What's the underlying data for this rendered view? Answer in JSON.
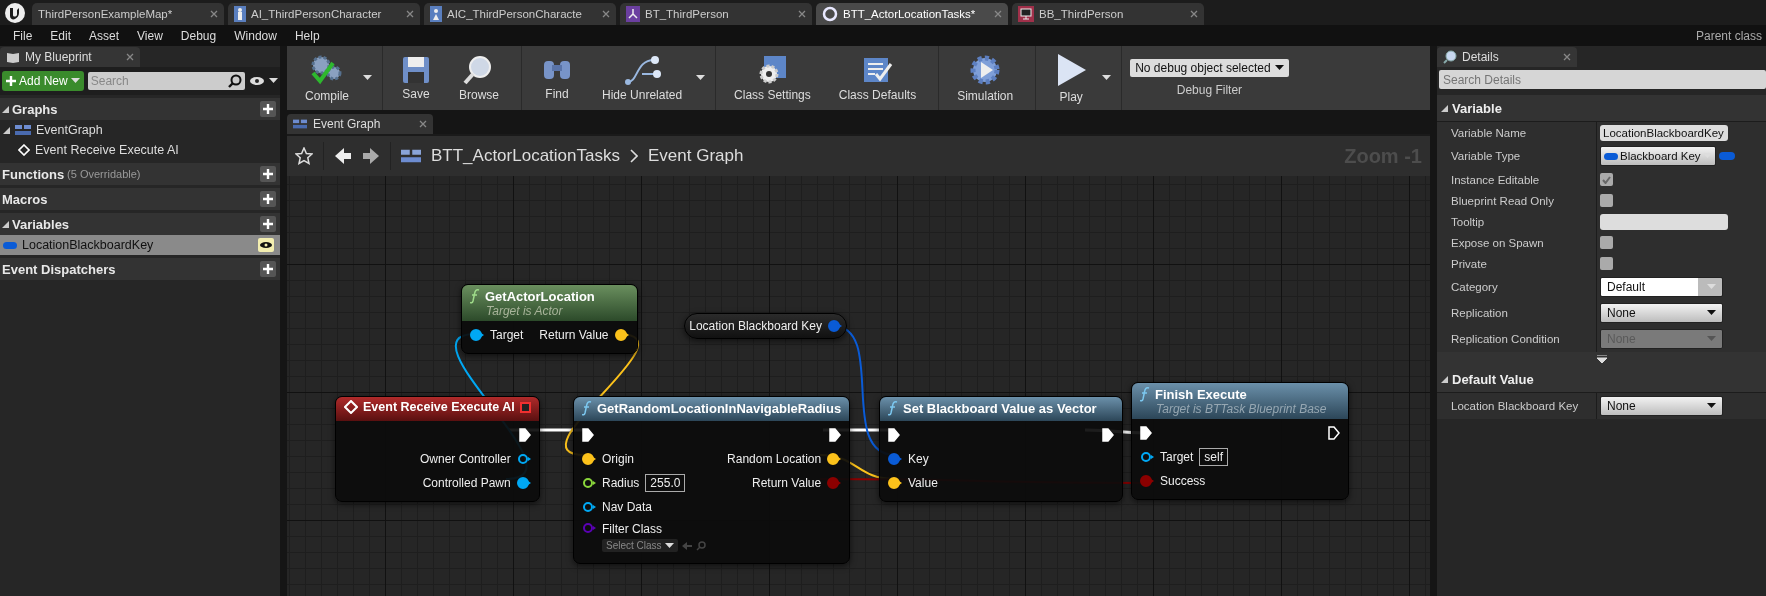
{
  "tabs": [
    {
      "label": "ThirdPersonExampleMap*",
      "kind": "level",
      "selected": false
    },
    {
      "label": "AI_ThirdPersonCharacter",
      "kind": "character",
      "selected": false
    },
    {
      "label": "AIC_ThirdPersonCharacte",
      "kind": "controller",
      "selected": false
    },
    {
      "label": "BT_ThirdPerson",
      "kind": "tree",
      "selected": false
    },
    {
      "label": "BTT_ActorLocationTasks*",
      "kind": "task",
      "selected": true
    },
    {
      "label": "BB_ThirdPerson",
      "kind": "blackboard",
      "selected": false
    }
  ],
  "menu": [
    "File",
    "Edit",
    "Asset",
    "View",
    "Debug",
    "Window",
    "Help"
  ],
  "parent_class": "Parent class",
  "my_blueprint": {
    "title": "My Blueprint",
    "add_button": "Add New",
    "search": {
      "placeholder": "Search"
    },
    "sections": [
      {
        "label": "Graphs",
        "expanded": true,
        "items": [
          {
            "label": "EventGraph",
            "kind": "graph",
            "selected": false,
            "children": [
              {
                "label": "Event Receive Execute AI",
                "kind": "event",
                "selected": false
              }
            ]
          }
        ]
      },
      {
        "label": "Functions",
        "note": "(5 Overridable)",
        "expanded": false
      },
      {
        "label": "Macros",
        "expanded": false
      },
      {
        "label": "Variables",
        "expanded": true,
        "items": [
          {
            "label": "LocationBlackboardKey",
            "kind": "variable",
            "selected": true
          }
        ]
      },
      {
        "label": "Event Dispatchers",
        "expanded": false
      }
    ]
  },
  "toolbar": {
    "groups": [
      [
        {
          "label": "Compile",
          "kind": "compile",
          "menu": true
        }
      ],
      [
        {
          "label": "Save",
          "kind": "save",
          "menu": false
        },
        {
          "label": "Browse",
          "kind": "browse",
          "menu": false
        }
      ],
      [
        {
          "label": "Find",
          "kind": "find",
          "menu": false
        },
        {
          "label": "Hide Unrelated",
          "kind": "hide",
          "menu": true
        }
      ],
      [
        {
          "label": "Class Settings",
          "kind": "settings",
          "menu": false
        },
        {
          "label": "Class Defaults",
          "kind": "defaults",
          "menu": false
        }
      ],
      [
        {
          "label": "Simulation",
          "kind": "simulation",
          "menu": false
        }
      ],
      [
        {
          "label": "Play",
          "kind": "play",
          "menu": true
        }
      ]
    ],
    "debug_filter": {
      "value": "No debug object selected",
      "label": "Debug Filter"
    }
  },
  "graph_tab": {
    "label": "Event Graph"
  },
  "breadcrumb": {
    "path": [
      "BTT_ActorLocationTasks",
      "Event Graph"
    ],
    "zoom": "Zoom -1"
  },
  "nodes": [
    {
      "kind": "pure",
      "title": "GetActorLocation",
      "subtitle": "Target is Actor",
      "inputs": [
        {
          "kind": "data",
          "label": "Target",
          "color": "#00a8f4",
          "connected": true
        }
      ],
      "outputs": [
        {
          "kind": "data",
          "label": "Return Value",
          "color": "#fcc21b",
          "connected": true
        }
      ]
    },
    {
      "kind": "variable",
      "title": "Location Blackboard Key",
      "outputs": [
        {
          "kind": "data",
          "color": "#0a5bd6",
          "connected": true
        }
      ]
    },
    {
      "kind": "event",
      "title": "Event Receive Execute AI",
      "outputs": [
        {
          "kind": "exec",
          "connected": true
        },
        {
          "kind": "data",
          "label": "Owner Controller",
          "color": "#00a8f4",
          "connected": false
        },
        {
          "kind": "data",
          "label": "Controlled Pawn",
          "color": "#00a8f4",
          "connected": true
        }
      ]
    },
    {
      "kind": "function",
      "title": "GetRandomLocationInNavigableRadius",
      "inputs": [
        {
          "kind": "exec",
          "connected": true
        },
        {
          "kind": "data",
          "label": "Origin",
          "color": "#fcc21b",
          "connected": true
        },
        {
          "kind": "data",
          "label": "Radius",
          "color": "#8ad63b",
          "connected": false,
          "value": "255.0"
        },
        {
          "kind": "data",
          "label": "Nav Data",
          "color": "#00a8f4",
          "connected": false
        },
        {
          "kind": "class",
          "label": "Filter Class",
          "color": "#5a00b4",
          "connected": false,
          "value": "Select Class"
        }
      ],
      "outputs": [
        {
          "kind": "exec",
          "connected": true
        },
        {
          "kind": "data",
          "label": "Random Location",
          "color": "#fcc21b",
          "connected": true
        },
        {
          "kind": "data",
          "label": "Return Value",
          "color": "#8b0000",
          "connected": true
        }
      ]
    },
    {
      "kind": "function",
      "title": "Set Blackboard Value as Vector",
      "inputs": [
        {
          "kind": "exec",
          "connected": true
        },
        {
          "kind": "data",
          "label": "Key",
          "color": "#0a5bd6",
          "connected": true
        },
        {
          "kind": "data",
          "label": "Value",
          "color": "#fcc21b",
          "connected": true
        }
      ],
      "outputs": [
        {
          "kind": "exec",
          "connected": true
        }
      ]
    },
    {
      "kind": "function",
      "title": "Finish Execute",
      "subtitle": "Target is BTTask Blueprint Base",
      "inputs": [
        {
          "kind": "exec",
          "connected": true
        },
        {
          "kind": "data",
          "label": "Target",
          "color": "#00a8f4",
          "connected": false,
          "value": "self"
        },
        {
          "kind": "data",
          "label": "Success",
          "color": "#8b0000",
          "connected": true
        }
      ],
      "outputs": [
        {
          "kind": "exec",
          "connected": false
        }
      ]
    }
  ],
  "details": {
    "title": "Details",
    "search": {
      "placeholder": "Search Details"
    },
    "sections": [
      {
        "title": "Variable",
        "advanced": true,
        "rows": [
          {
            "label": "Variable Name",
            "kind": "text",
            "value": "LocationBlackboardKey"
          },
          {
            "label": "Variable Type",
            "kind": "type",
            "value": "Blackboard Key"
          },
          {
            "label": "Instance Editable",
            "kind": "checkbox",
            "checked": true
          },
          {
            "label": "Blueprint Read Only",
            "kind": "checkbox",
            "checked": false
          },
          {
            "label": "Tooltip",
            "kind": "text"
          },
          {
            "label": "Expose on Spawn",
            "kind": "checkbox",
            "checked": false
          },
          {
            "label": "Private",
            "kind": "checkbox",
            "checked": false
          },
          {
            "label": "Category",
            "kind": "combo",
            "value": "Default"
          },
          {
            "label": "Replication",
            "kind": "dropdown",
            "value": "None",
            "disabled": false
          },
          {
            "label": "Replication Condition",
            "kind": "dropdown",
            "value": "None",
            "disabled": true
          }
        ]
      },
      {
        "title": "Default Value",
        "advanced": false,
        "rows": [
          {
            "label": "Location Blackboard Key",
            "kind": "dropdown",
            "value": "None",
            "disabled": false
          }
        ]
      }
    ]
  }
}
